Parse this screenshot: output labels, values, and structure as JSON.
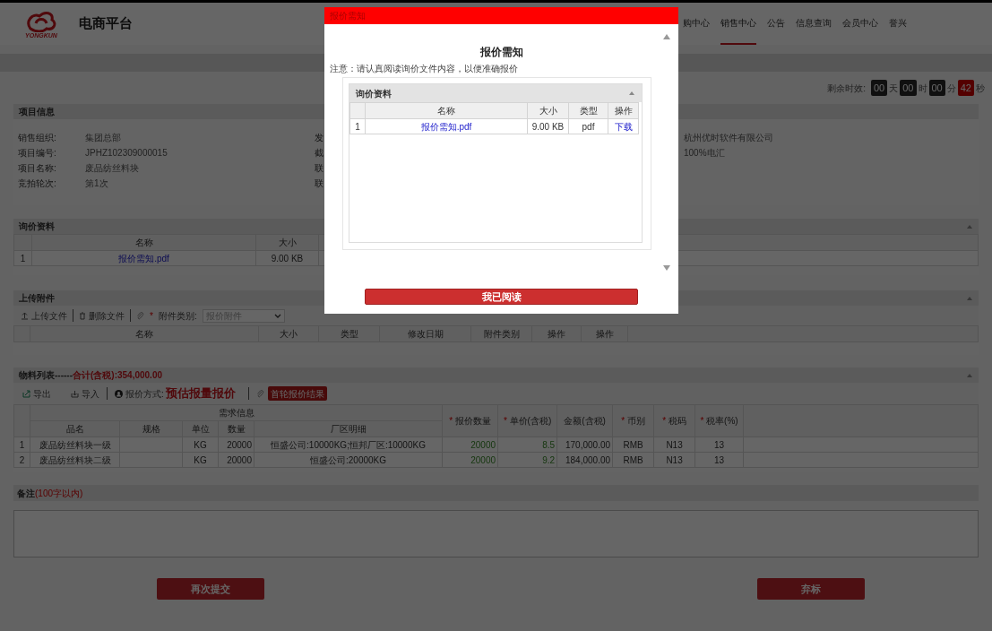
{
  "header": {
    "logo_caption": "YONGKUN",
    "title": "电商平台"
  },
  "nav": [
    {
      "label": "购中心",
      "selected": false
    },
    {
      "label": "销售中心",
      "selected": true
    },
    {
      "label": "公告",
      "selected": false
    },
    {
      "label": "信息查询",
      "selected": false
    },
    {
      "label": "会员中心",
      "selected": false
    },
    {
      "label": "誉兴",
      "selected": false
    }
  ],
  "countdown": {
    "label": "剩余时效:",
    "units": [
      {
        "value": "00",
        "unit": "天",
        "urgent": false
      },
      {
        "value": "00",
        "unit": "时",
        "urgent": false
      },
      {
        "value": "00",
        "unit": "分",
        "urgent": false
      },
      {
        "value": "42",
        "unit": "秒",
        "urgent": true
      }
    ]
  },
  "project_info": {
    "title": "项目信息",
    "fields": [
      {
        "label": "销售组织:",
        "value": "集团总部",
        "column_2_label": "发",
        "column_3_value": "杭州优时软件有限公司"
      },
      {
        "label": "项目编号:",
        "value": "JPHZ102309000015",
        "column_2_label": "截",
        "column_3_value": "100%电汇"
      },
      {
        "label": "项目名称:",
        "value": "废品纺丝料块",
        "column_2_label": "联"
      },
      {
        "label": "竞拍轮次:",
        "value": "第1次",
        "column_2_label": "联"
      }
    ]
  },
  "inquiry_panel": {
    "title": "询价资料",
    "columns": [
      "名称",
      "大小"
    ],
    "rows": [
      {
        "index": "1",
        "cells": [
          "报价需知.pdf",
          "9.00 KB"
        ]
      }
    ]
  },
  "upload_panel": {
    "title": "上传附件",
    "upload": "上传文件",
    "delete": "删除文件",
    "type_mark": "*",
    "type_label": "附件类别:",
    "type_value": "报价附件",
    "columns": [
      "名称",
      "大小",
      "类型",
      "修改日期",
      "附件类别",
      "操作",
      "操作"
    ]
  },
  "materials": {
    "title": "物料列表------",
    "total": "合计(含税):354,000.00",
    "export": "导出",
    "import": "导入",
    "mode_label": "报价方式:",
    "mode_value": "预估报量报价",
    "result_button": "首轮报价结果",
    "group_header": "需求信息",
    "demand_columns": [
      "品名",
      "规格",
      "单位",
      "数量",
      "厂区明细"
    ],
    "quote_columns": [
      {
        "label": "报价数量",
        "mark": "*"
      },
      {
        "label": "单价(含税)",
        "mark": "*"
      },
      {
        "label": "金额(含税)"
      },
      {
        "label": "币别",
        "mark": "*"
      },
      {
        "label": "税码",
        "mark": "*"
      },
      {
        "label": "税率(%)",
        "mark": "*"
      }
    ],
    "rows": [
      {
        "index": "1",
        "demand": {
          "name": "废品纺丝料块一级",
          "unit": "KG",
          "quantity": "20000",
          "plant_detail": "恒盛公司:10000KG;恒邦厂区:10000KG"
        },
        "quote": [
          "20000",
          "8.5",
          "170,000.00",
          "RMB",
          "N13",
          "13"
        ]
      },
      {
        "index": "2",
        "demand": {
          "name": "废品纺丝料块二级",
          "unit": "KG",
          "quantity": "20000",
          "plant_detail": "恒盛公司:20000KG"
        },
        "quote": [
          "20000",
          "9.2",
          "184,000.00",
          "RMB",
          "N13",
          "13"
        ]
      }
    ]
  },
  "remarks": {
    "label": "备注",
    "hint": "(100字以内)"
  },
  "actions": [
    "再次提交",
    "弃标"
  ],
  "modal": {
    "title": "报价需知",
    "heading": "报价需知",
    "note": "注意：请认真阅读询价文件内容，以便准确报价",
    "panel_title": "询价资料",
    "columns": [
      "名称",
      "大小",
      "类型",
      "操作"
    ],
    "rows": [
      {
        "index": "1",
        "cells": [
          "报价需知.pdf",
          "9.00 KB",
          "pdf",
          "下载"
        ]
      }
    ],
    "confirm": "我已阅读"
  }
}
